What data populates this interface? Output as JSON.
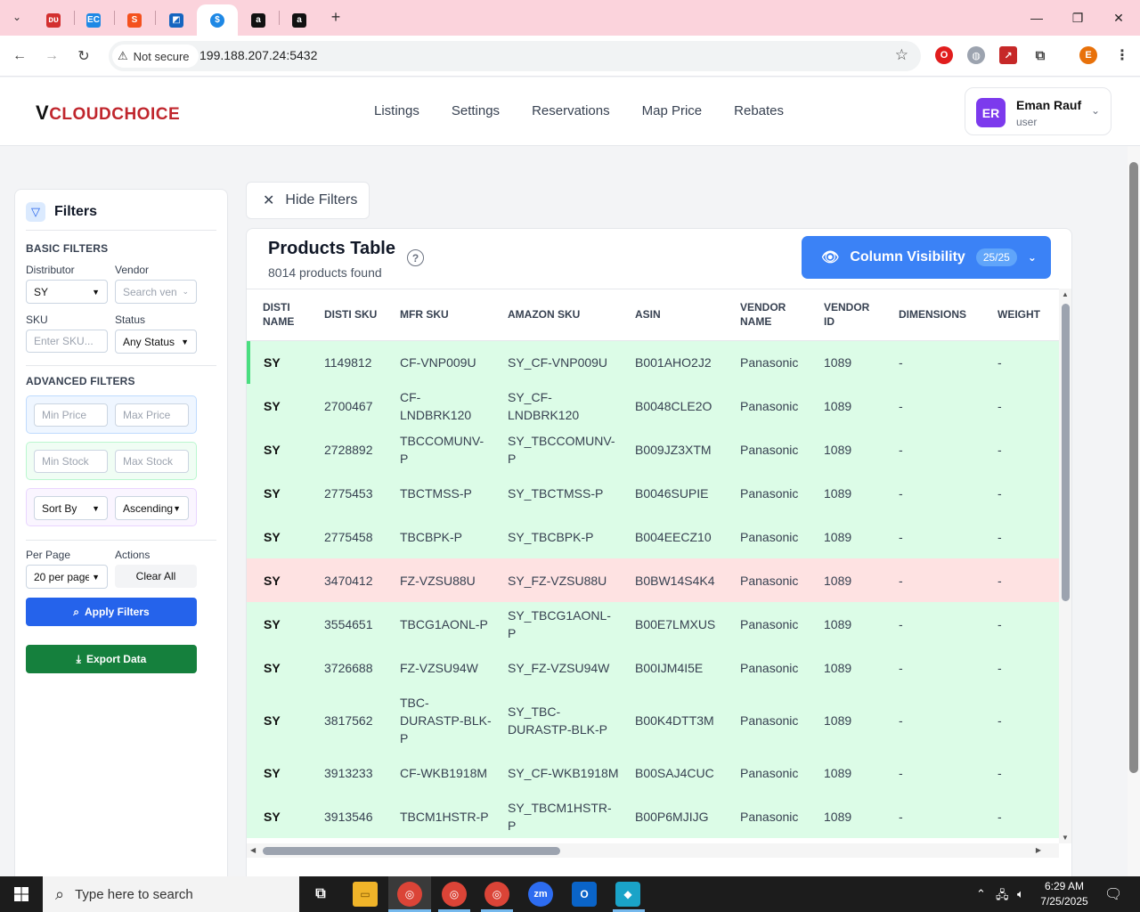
{
  "browser": {
    "tabs": [
      {
        "name": "tab-1",
        "glyph": "ᴅᴜ",
        "color": "#d32f2f"
      },
      {
        "name": "tab-2",
        "glyph": "EC",
        "color": "#1e88e5"
      },
      {
        "name": "tab-3",
        "glyph": "S",
        "color": "#f4511e"
      },
      {
        "name": "tab-4",
        "glyph": "◩",
        "color": "#1565c0"
      },
      {
        "name": "tab-5",
        "glyph": "$",
        "color": "#1e88e5"
      },
      {
        "name": "tab-6",
        "glyph": "a",
        "color": "#111111"
      },
      {
        "name": "tab-7",
        "glyph": "a",
        "color": "#111111"
      }
    ],
    "not_secure": "Not secure",
    "url": "199.188.207.24:5432",
    "profile_initial": "E"
  },
  "app": {
    "logo": "CLOUDCHOICE",
    "logo_mark": "V",
    "nav": [
      "Listings",
      "Settings",
      "Reservations",
      "Map Price",
      "Rebates"
    ],
    "user": {
      "initials": "ER",
      "name": "Eman Rauf",
      "role": "user"
    }
  },
  "filters": {
    "title": "Filters",
    "basic_label": "BASIC FILTERS",
    "distributor_label": "Distributor",
    "distributor_value": "SY",
    "vendor_label": "Vendor",
    "vendor_placeholder": "Search ven",
    "sku_label": "SKU",
    "sku_placeholder": "Enter SKU...",
    "status_label": "Status",
    "status_value": "Any Status",
    "advanced_label": "ADVANCED FILTERS",
    "min_price": "Min Price",
    "max_price": "Max Price",
    "min_stock": "Min Stock",
    "max_stock": "Max Stock",
    "sort_by": "Sort By",
    "order": "Ascending",
    "per_page_label": "Per Page",
    "per_page_value": "20 per page",
    "actions_label": "Actions",
    "clear_all": "Clear All",
    "apply": "Apply Filters",
    "export": "Export Data"
  },
  "main": {
    "hide_filters": "Hide Filters",
    "table_title": "Products Table",
    "count": "8014 products found",
    "column_visibility": "Column Visibility",
    "column_badge": "25/25",
    "columns": [
      "DISTI NAME",
      "DISTI SKU",
      "MFR SKU",
      "AMAZON SKU",
      "ASIN",
      "VENDOR NAME",
      "VENDOR ID",
      "DIMENSIONS",
      "WEIGHT"
    ],
    "rows": [
      {
        "status": "ok",
        "cells": [
          "SY",
          "1149812",
          "CF-VNP009U",
          "SY_CF-VNP009U",
          "B001AHO2J2",
          "Panasonic",
          "1089",
          "-",
          "-"
        ]
      },
      {
        "status": "ok",
        "cells": [
          "SY",
          "2700467",
          "CF-LNDBRK120",
          "SY_CF-LNDBRK120",
          "B0048CLE2O",
          "Panasonic",
          "1089",
          "-",
          "-"
        ]
      },
      {
        "status": "ok",
        "cells": [
          "SY",
          "2728892",
          "TBCCOMUNV-P",
          "SY_TBCCOMUNV-P",
          "B009JZ3XTM",
          "Panasonic",
          "1089",
          "-",
          "-"
        ]
      },
      {
        "status": "ok",
        "cells": [
          "SY",
          "2775453",
          "TBCTMSS-P",
          "SY_TBCTMSS-P",
          "B0046SUPIE",
          "Panasonic",
          "1089",
          "-",
          "-"
        ]
      },
      {
        "status": "ok",
        "cells": [
          "SY",
          "2775458",
          "TBCBPK-P",
          "SY_TBCBPK-P",
          "B004EECZ10",
          "Panasonic",
          "1089",
          "-",
          "-"
        ]
      },
      {
        "status": "bad",
        "cells": [
          "SY",
          "3470412",
          "FZ-VZSU88U",
          "SY_FZ-VZSU88U",
          "B0BW14S4K4",
          "Panasonic",
          "1089",
          "-",
          "-"
        ]
      },
      {
        "status": "ok",
        "cells": [
          "SY",
          "3554651",
          "TBCG1AONL-P",
          "SY_TBCG1AONL-P",
          "B00E7LMXUS",
          "Panasonic",
          "1089",
          "-",
          "-"
        ]
      },
      {
        "status": "ok",
        "cells": [
          "SY",
          "3726688",
          "FZ-VZSU94W",
          "SY_FZ-VZSU94W",
          "B00IJM4I5E",
          "Panasonic",
          "1089",
          "-",
          "-"
        ]
      },
      {
        "status": "ok",
        "cells": [
          "SY",
          "3817562",
          "TBC-DURASTP-BLK-P",
          "SY_TBC-DURASTP-BLK-P",
          "B00K4DTT3M",
          "Panasonic",
          "1089",
          "-",
          "-"
        ]
      },
      {
        "status": "ok",
        "cells": [
          "SY",
          "3913233",
          "CF-WKB1918M",
          "SY_CF-WKB1918M",
          "B00SAJ4CUC",
          "Panasonic",
          "1089",
          "-",
          "-"
        ]
      },
      {
        "status": "ok",
        "cells": [
          "SY",
          "3913546",
          "TBCM1HSTR-P",
          "SY_TBCM1HSTR-P",
          "B00P6MJIJG",
          "Panasonic",
          "1089",
          "-",
          "-"
        ]
      }
    ]
  },
  "taskbar": {
    "search_placeholder": "Type here to search",
    "time": "6:29 AM",
    "date": "7/25/2025"
  }
}
